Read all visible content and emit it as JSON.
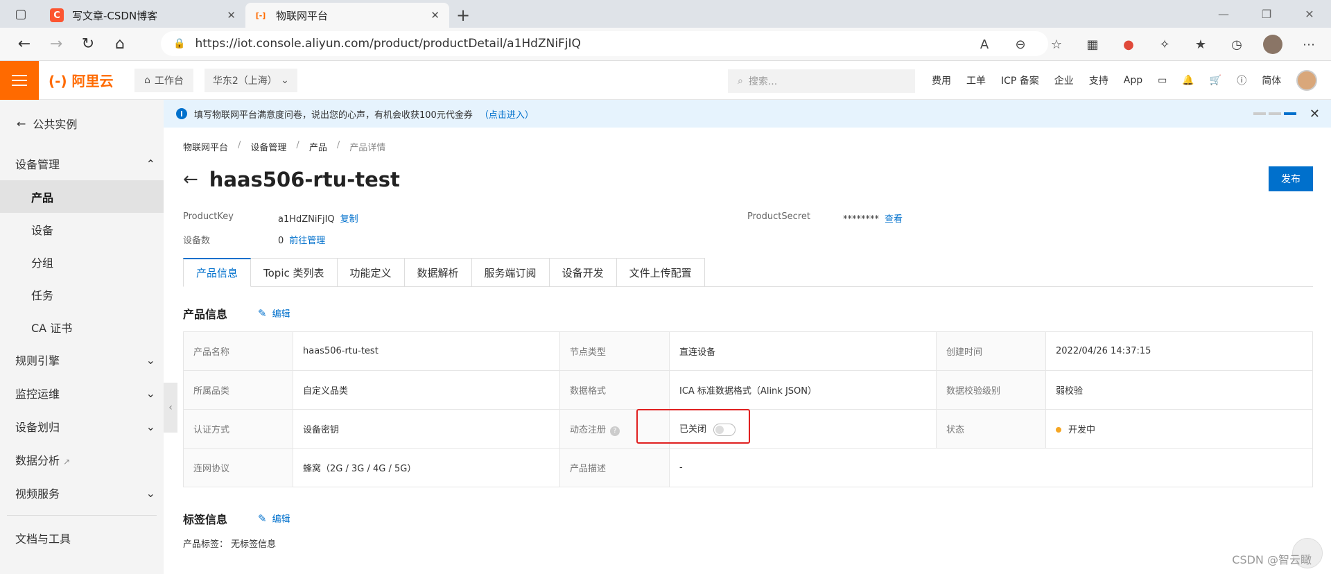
{
  "browser": {
    "tabs": [
      {
        "title": "写文章-CSDN博客",
        "icon": "C",
        "color": "#fc5531"
      },
      {
        "title": "物联网平台",
        "icon": "[-]",
        "color": "#ff6a00"
      }
    ],
    "url": "https://iot.console.aliyun.com/product/productDetail/a1HdZNiFjIQ"
  },
  "console": {
    "logo": "(-) 阿里云",
    "workspace": "工作台",
    "region": "华东2（上海）",
    "search_placeholder": "搜索...",
    "nav": [
      "费用",
      "工单",
      "ICP 备案",
      "企业",
      "支持",
      "App",
      "简体"
    ]
  },
  "sidebar": {
    "back": "公共实例",
    "sections": [
      {
        "label": "设备管理",
        "items": [
          "产品",
          "设备",
          "分组",
          "任务",
          "CA 证书"
        ]
      },
      {
        "label": "规则引擎"
      },
      {
        "label": "监控运维"
      },
      {
        "label": "设备划归"
      },
      {
        "label": "数据分析"
      },
      {
        "label": "视频服务"
      }
    ],
    "footer": "文档与工具"
  },
  "notice": {
    "text": "填写物联网平台满意度问卷，说出您的心声，有机会收获100元代金券",
    "link": "（点击进入）"
  },
  "breadcrumb": [
    "物联网平台",
    "设备管理",
    "产品",
    "产品详情"
  ],
  "product": {
    "name": "haas506-rtu-test",
    "publish_label": "发布",
    "product_key_label": "ProductKey",
    "product_key": "a1HdZNiFjIQ",
    "copy_label": "复制",
    "device_count_label": "设备数",
    "device_count": "0",
    "manage_label": "前往管理",
    "secret_label": "ProductSecret",
    "secret": "********",
    "view_label": "查看"
  },
  "tabs": [
    "产品信息",
    "Topic 类列表",
    "功能定义",
    "数据解析",
    "服务端订阅",
    "设备开发",
    "文件上传配置"
  ],
  "info_section": {
    "title": "产品信息",
    "edit": "编辑"
  },
  "info_table": {
    "row1": {
      "k1": "产品名称",
      "v1": "haas506-rtu-test",
      "k2": "节点类型",
      "v2": "直连设备",
      "k3": "创建时间",
      "v3": "2022/04/26 14:37:15"
    },
    "row2": {
      "k1": "所属品类",
      "v1": "自定义品类",
      "k2": "数据格式",
      "v2": "ICA 标准数据格式（Alink JSON）",
      "k3": "数据校验级别",
      "v3": "弱校验"
    },
    "row3": {
      "k1": "认证方式",
      "v1": "设备密钥",
      "k2": "动态注册",
      "v2": "已关闭",
      "k3": "状态",
      "v3": "开发中"
    },
    "row4": {
      "k1": "连网协议",
      "v1": "蜂窝（2G / 3G / 4G / 5G）",
      "k2": "产品描述",
      "v2": "-"
    }
  },
  "tag_section": {
    "title": "标签信息",
    "edit": "编辑",
    "tag_label": "产品标签：",
    "tag_value": "无标签信息"
  },
  "watermark": "CSDN @智云瞰"
}
